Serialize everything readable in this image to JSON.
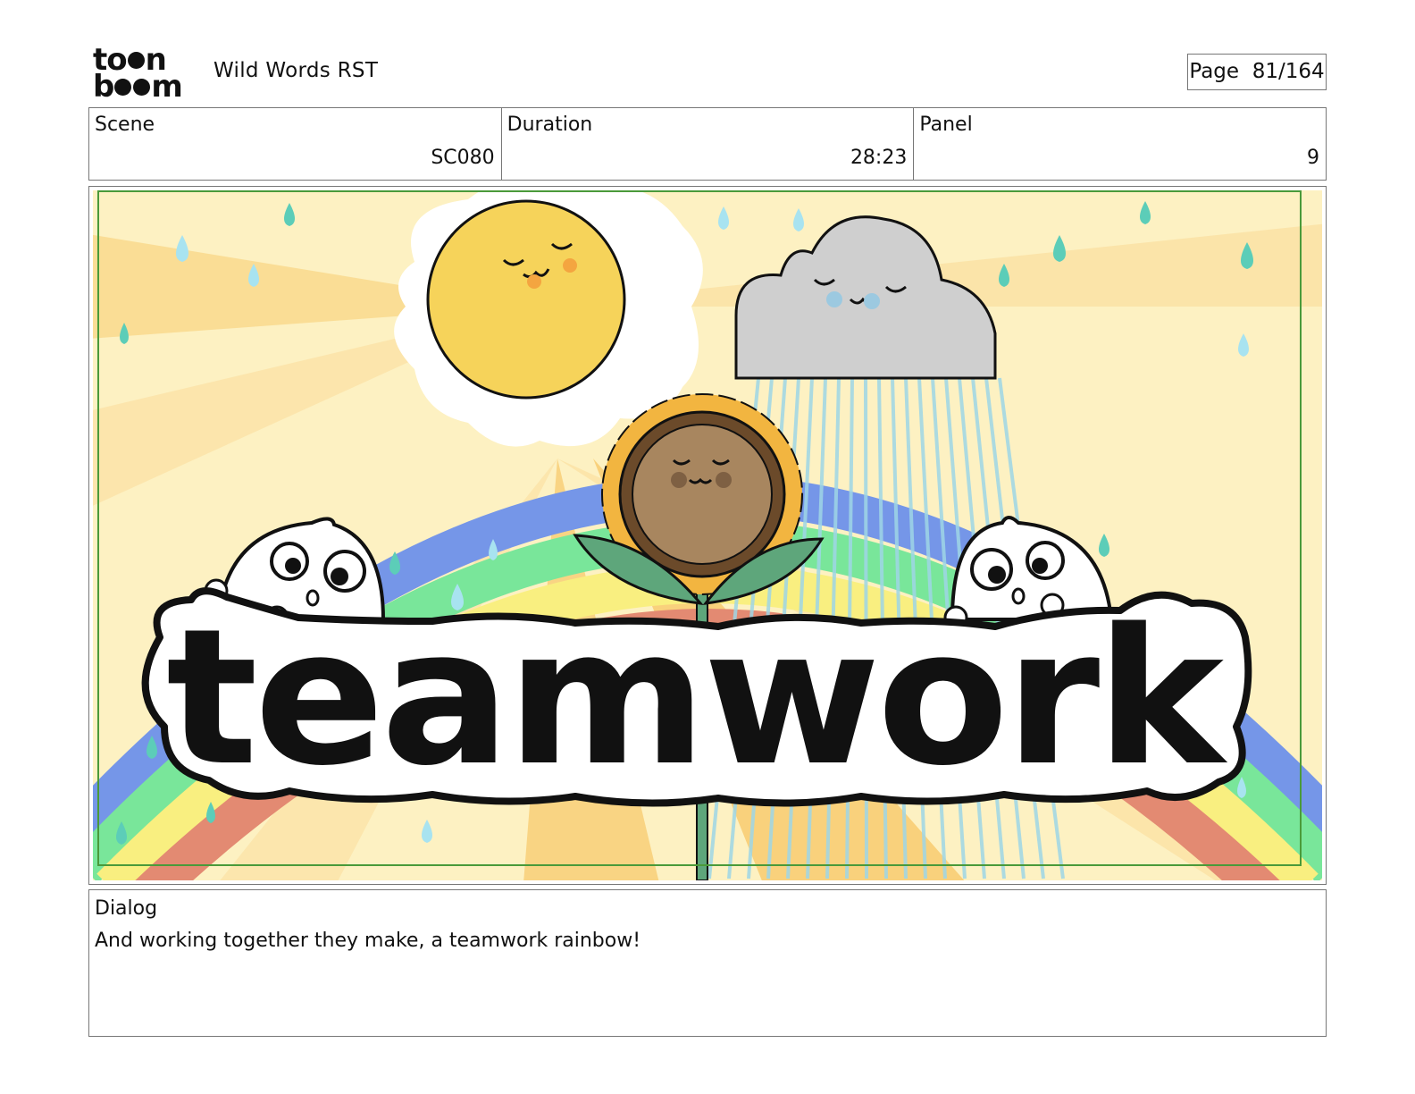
{
  "header": {
    "logo_top": "to",
    "logo_top_end": "n",
    "logo_bottom_start": "b",
    "logo_bottom_end": "m",
    "project_title": "Wild Words RST",
    "page_label": "Page",
    "page_value": "81/164"
  },
  "info": {
    "scene_label": "Scene",
    "scene_value": "SC080",
    "duration_label": "Duration",
    "duration_value": "28:23",
    "panel_label": "Panel",
    "panel_value": "9"
  },
  "panel": {
    "banner_text": "teamwork",
    "colors": {
      "sky": "#fdf1c2",
      "ray": "#f9d483",
      "blue": "#7596e8",
      "green": "#79e69a",
      "yellow": "#f9ef80",
      "red": "#e38a72",
      "sun": "#f6d35a",
      "cloud": "#cfcfcf",
      "drop_teal": "#5ccdb8",
      "drop_blue": "#a8e3f0",
      "flower_petal": "#f2b540",
      "flower_center": "#a8865f",
      "leaf": "#5ea67b",
      "frame_green": "#4a9a3a"
    }
  },
  "dialog": {
    "label": "Dialog",
    "text": "And working together they make, a teamwork rainbow!"
  }
}
